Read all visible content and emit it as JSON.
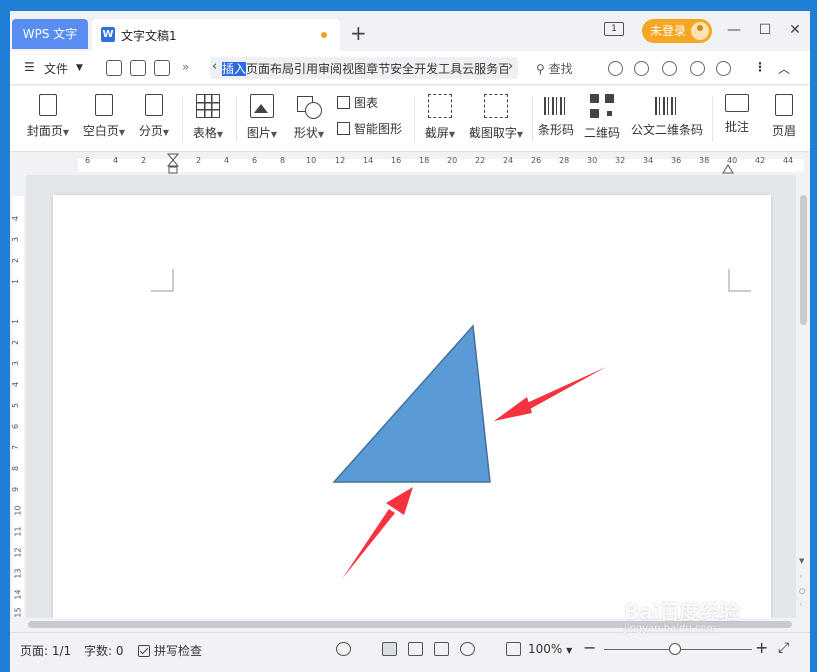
{
  "titlebar": {
    "app_tab": "WPS 文字",
    "doc_tab": "文字文稿1",
    "doc_icon_letter": "W",
    "new_tab": "+",
    "page_badge": "1",
    "login": "未登录",
    "minimize": "—",
    "maximize": "☐",
    "close": "✕"
  },
  "menubar": {
    "file": "文件",
    "more": "»",
    "tabs": [
      {
        "label": "插入",
        "selected": true
      },
      {
        "label": "页面布局",
        "selected": false
      },
      {
        "label": "引用",
        "selected": false
      },
      {
        "label": "审阅",
        "selected": false
      },
      {
        "label": "视图",
        "selected": false
      },
      {
        "label": "章节",
        "selected": false
      },
      {
        "label": "安全",
        "selected": false
      },
      {
        "label": "开发工具",
        "selected": false
      },
      {
        "label": "云服务",
        "selected": false
      },
      {
        "label": "百",
        "selected": false
      }
    ],
    "search": "查找"
  },
  "ribbon": {
    "cover": "封面页",
    "blank": "空白页",
    "pagebreak": "分页",
    "table": "表格",
    "picture": "图片",
    "shape": "形状",
    "chart": "图表",
    "smartart": "智能图形",
    "screenshot": "截屏",
    "ocr": "截图取字",
    "barcode": "条形码",
    "qrcode": "二维码",
    "pdf417": "公文二维条码",
    "comment": "批注",
    "header": "页眉"
  },
  "hruler": [
    "6",
    "4",
    "2",
    "2",
    "4",
    "6",
    "8",
    "10",
    "12",
    "14",
    "16",
    "18",
    "20",
    "22",
    "24",
    "26",
    "28",
    "30",
    "32",
    "34",
    "36",
    "38",
    "40",
    "42",
    "44"
  ],
  "vruler": [
    "4",
    "3",
    "2",
    "1",
    "1",
    "2",
    "3",
    "4",
    "5",
    "6",
    "7",
    "8",
    "9",
    "10",
    "11",
    "12",
    "13",
    "14",
    "15"
  ],
  "status": {
    "page": "页面: 1/1",
    "words": "字数: 0",
    "spellcheck": "拼写检查",
    "zoom": "100%",
    "minus": "−",
    "plus": "+"
  },
  "shapes": {
    "triangle_color": "#5b9bd5",
    "triangle_stroke": "#41719c",
    "arrow_color": "#f5333f"
  },
  "watermark": {
    "brand": "Bai百度经验",
    "url": "jingyan.baidu.com"
  }
}
